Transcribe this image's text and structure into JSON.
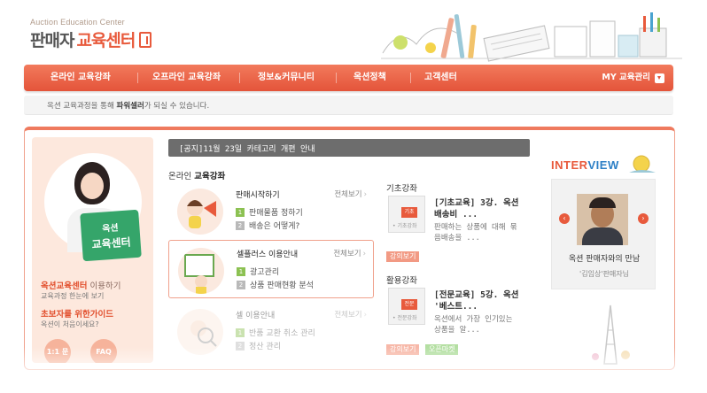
{
  "logo": {
    "subtitle": "Auction Education Center",
    "title_part1": "판매자",
    "title_part2": "교육센터"
  },
  "nav": {
    "items": [
      "온라인 교육강좌",
      "오프라인 교육강좌",
      "정보&커뮤니티",
      "옥션정책",
      "고객센터"
    ],
    "my_menu": "MY 교육관리"
  },
  "tagline": {
    "prefix": "옥션 교육과정을 통해 ",
    "bold": "파워셀러",
    "suffix": "가 되실 수 있습니다."
  },
  "promo": {
    "tag_line1": "옥션",
    "tag_line2": "교육센터",
    "link1_main": "옥션교육센터",
    "link1_rest": " 이용하기",
    "sub1": "교육과정 한눈에 보기",
    "link2": "초보자를 위한가이드",
    "sub2": "옥션이 처음이세요?",
    "btn1": "1:1 문의",
    "btn2": "FAQ"
  },
  "notice": "[공지]11월 23일 카테고리 개편 안내",
  "online_section": {
    "prefix": "온라인 ",
    "bold": "교육강좌"
  },
  "courses": [
    {
      "title": "판매시작하기",
      "more": "전체보기",
      "items": [
        "판매물품 정하기",
        "배송은 어떻게?"
      ]
    },
    {
      "title": "셀플러스 이용안내",
      "more": "전체보기",
      "items": [
        "광고관리",
        "상품 판매현황 분석"
      ]
    },
    {
      "title": "셀 이용안내",
      "more": "전체보기",
      "items": [
        "반품 교환 취소 관리",
        "정산 관리"
      ]
    }
  ],
  "basic": {
    "title": "기초강좌",
    "thumb_label": "• 기초강좌",
    "thumb_tag": "기초",
    "lecture_title_1": "[기초교육] 3강. 옥션",
    "lecture_title_2": "배송비 ...",
    "desc_1": "판매하는 상품에 대해 묶",
    "desc_2": "음배송을 ...",
    "tag": "강의보기"
  },
  "advanced": {
    "title": "활용강좌",
    "thumb_label": "• 전문강좌",
    "thumb_tag": "전문",
    "lecture_title_1": "[전문교육] 5강. 옥션",
    "lecture_title_2": "'베스트...",
    "desc_1": "옥션에서 가장 인기있는",
    "desc_2": "상품을 알...",
    "tag1": "강의보기",
    "tag2": "오픈마켓"
  },
  "interview": {
    "label_part1": "INTER",
    "label_part2": "VIEW",
    "name": "옥션 판매자와의 만남",
    "sub": "'김임상'판매자님"
  },
  "colors": {
    "accent": "#e85a3c",
    "nav_top": "#f27a5c",
    "green": "#35a56a",
    "blue": "#2c7fc6"
  }
}
